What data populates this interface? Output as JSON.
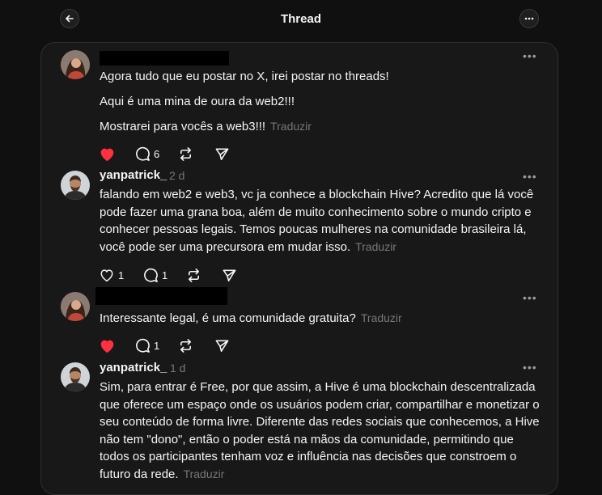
{
  "header": {
    "title": "Thread"
  },
  "posts": [
    {
      "author": "",
      "time": "",
      "paragraphs": [
        "Agora tudo que eu postar no X, irei postar no threads!",
        "Aqui é uma mina de oura da web2!!!",
        "Mostrarei para vocês a web3!!!"
      ],
      "translate": "Traduzir",
      "liked": true,
      "likes": "",
      "replies": "6"
    },
    {
      "author": "yanpatrick_",
      "time": "2 d",
      "text": "falando em web2 e web3, vc ja conhece a blockchain Hive? Acredito que lá você pode fazer uma grana boa, além de muito conhecimento sobre o mundo cripto e conhecer pessoas legais. Temos poucas mulheres na comunidade brasileira lá, você pode ser uma precursora em mudar isso.",
      "translate": "Traduzir",
      "liked": false,
      "likes": "1",
      "replies": "1"
    },
    {
      "author": "",
      "time": "",
      "text": "Interessante legal, é uma comunidade gratuita?",
      "translate": "Traduzir",
      "liked": true,
      "likes": "",
      "replies": "1"
    },
    {
      "author": "yanpatrick_",
      "time": "1 d",
      "text": "Sim, para entrar é Free, por que assim, a Hive é uma blockchain descentralizada que oferece um espaço onde os usuários podem criar, compartilhar e monetizar o seu conteúdo de forma livre. Diferente das redes sociais que conhecemos, a Hive não tem \"dono\", então o poder está na mãos da comunidade, permitindo que todos os participantes tenham voz e influência nas decisões que constroem o futuro da rede.",
      "translate": "Traduzir"
    }
  ],
  "icons": {
    "back": "arrow-left-icon",
    "more": "more-horizontal-icon",
    "like": "heart-icon",
    "reply": "comment-icon",
    "repost": "repost-icon",
    "share": "send-icon"
  },
  "colors": {
    "like": "#ff3040",
    "background": "#101010",
    "panel": "#181818",
    "muted": "#777777"
  }
}
